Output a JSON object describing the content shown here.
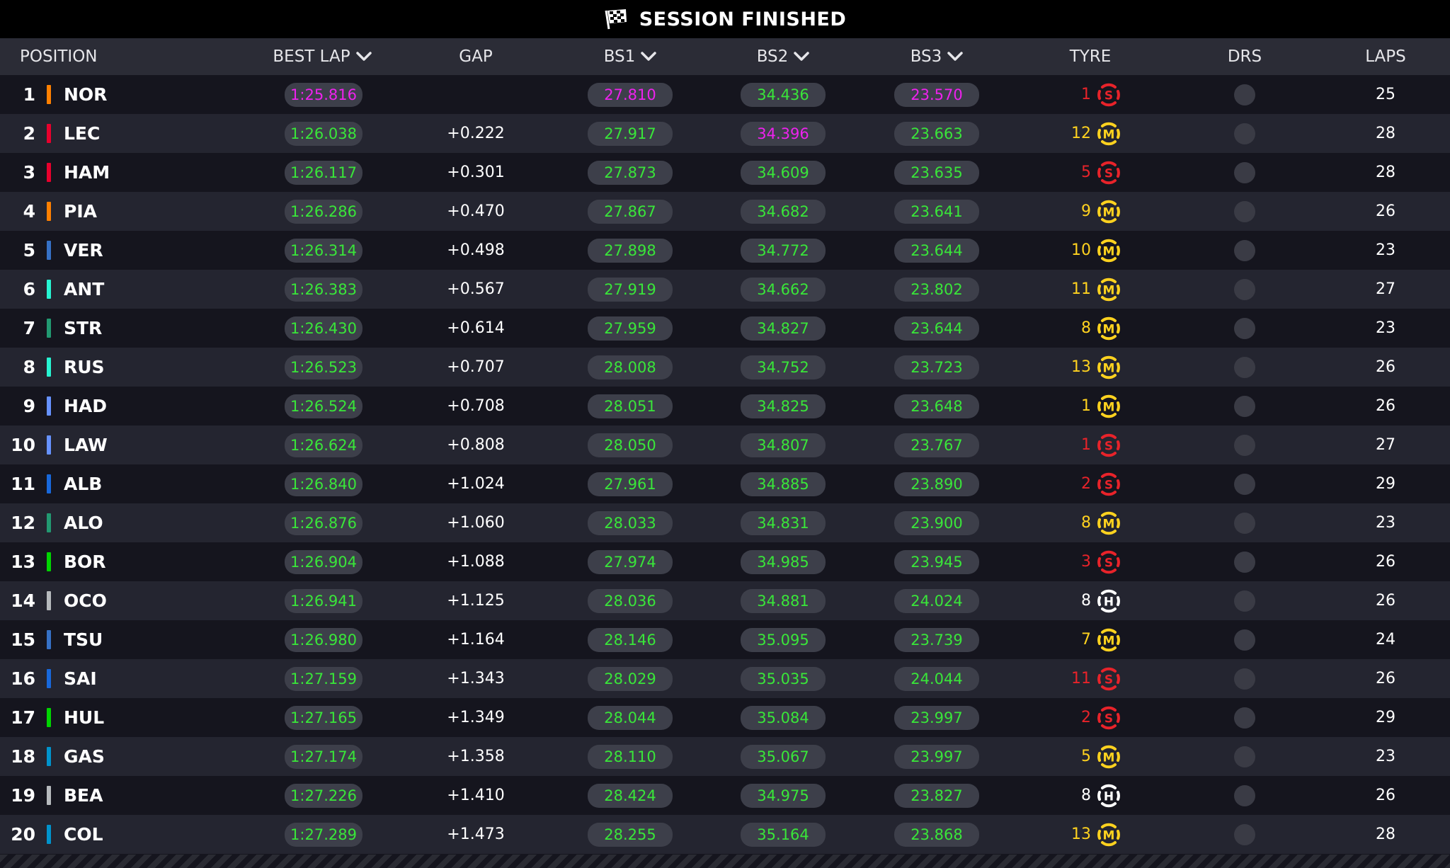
{
  "session_title": "SESSION FINISHED",
  "columns": {
    "position": "POSITION",
    "best_lap": "BEST LAP",
    "gap": "GAP",
    "bs1": "BS1",
    "bs2": "BS2",
    "bs3": "BS3",
    "tyre": "TYRE",
    "drs": "DRS",
    "laps": "LAPS"
  },
  "colors": {
    "personal_best": "#39e639",
    "overall_best": "#ee22ee",
    "soft": "#e8232a",
    "medium": "#ffd21f",
    "hard": "#ffffff"
  },
  "rows": [
    {
      "pos": "1",
      "driver": "NOR",
      "team_color": "#ff8000",
      "best_lap": "1:25.816",
      "best_lap_purple": true,
      "gap": "",
      "bs1": "27.810",
      "bs1_purple": true,
      "bs2": "34.436",
      "bs2_purple": false,
      "bs3": "23.570",
      "bs3_purple": true,
      "tyre_age": "1",
      "tyre": "S",
      "laps": "25"
    },
    {
      "pos": "2",
      "driver": "LEC",
      "team_color": "#e8002d",
      "best_lap": "1:26.038",
      "best_lap_purple": false,
      "gap": "+0.222",
      "bs1": "27.917",
      "bs1_purple": false,
      "bs2": "34.396",
      "bs2_purple": true,
      "bs3": "23.663",
      "bs3_purple": false,
      "tyre_age": "12",
      "tyre": "M",
      "laps": "28"
    },
    {
      "pos": "3",
      "driver": "HAM",
      "team_color": "#e8002d",
      "best_lap": "1:26.117",
      "best_lap_purple": false,
      "gap": "+0.301",
      "bs1": "27.873",
      "bs1_purple": false,
      "bs2": "34.609",
      "bs2_purple": false,
      "bs3": "23.635",
      "bs3_purple": false,
      "tyre_age": "5",
      "tyre": "S",
      "laps": "28"
    },
    {
      "pos": "4",
      "driver": "PIA",
      "team_color": "#ff8000",
      "best_lap": "1:26.286",
      "best_lap_purple": false,
      "gap": "+0.470",
      "bs1": "27.867",
      "bs1_purple": false,
      "bs2": "34.682",
      "bs2_purple": false,
      "bs3": "23.641",
      "bs3_purple": false,
      "tyre_age": "9",
      "tyre": "M",
      "laps": "26"
    },
    {
      "pos": "5",
      "driver": "VER",
      "team_color": "#3671c6",
      "best_lap": "1:26.314",
      "best_lap_purple": false,
      "gap": "+0.498",
      "bs1": "27.898",
      "bs1_purple": false,
      "bs2": "34.772",
      "bs2_purple": false,
      "bs3": "23.644",
      "bs3_purple": false,
      "tyre_age": "10",
      "tyre": "M",
      "laps": "23"
    },
    {
      "pos": "6",
      "driver": "ANT",
      "team_color": "#27f4d2",
      "best_lap": "1:26.383",
      "best_lap_purple": false,
      "gap": "+0.567",
      "bs1": "27.919",
      "bs1_purple": false,
      "bs2": "34.662",
      "bs2_purple": false,
      "bs3": "23.802",
      "bs3_purple": false,
      "tyre_age": "11",
      "tyre": "M",
      "laps": "27"
    },
    {
      "pos": "7",
      "driver": "STR",
      "team_color": "#229971",
      "best_lap": "1:26.430",
      "best_lap_purple": false,
      "gap": "+0.614",
      "bs1": "27.959",
      "bs1_purple": false,
      "bs2": "34.827",
      "bs2_purple": false,
      "bs3": "23.644",
      "bs3_purple": false,
      "tyre_age": "8",
      "tyre": "M",
      "laps": "23"
    },
    {
      "pos": "8",
      "driver": "RUS",
      "team_color": "#27f4d2",
      "best_lap": "1:26.523",
      "best_lap_purple": false,
      "gap": "+0.707",
      "bs1": "28.008",
      "bs1_purple": false,
      "bs2": "34.752",
      "bs2_purple": false,
      "bs3": "23.723",
      "bs3_purple": false,
      "tyre_age": "13",
      "tyre": "M",
      "laps": "26"
    },
    {
      "pos": "9",
      "driver": "HAD",
      "team_color": "#6692ff",
      "best_lap": "1:26.524",
      "best_lap_purple": false,
      "gap": "+0.708",
      "bs1": "28.051",
      "bs1_purple": false,
      "bs2": "34.825",
      "bs2_purple": false,
      "bs3": "23.648",
      "bs3_purple": false,
      "tyre_age": "1",
      "tyre": "M",
      "laps": "26"
    },
    {
      "pos": "10",
      "driver": "LAW",
      "team_color": "#6692ff",
      "best_lap": "1:26.624",
      "best_lap_purple": false,
      "gap": "+0.808",
      "bs1": "28.050",
      "bs1_purple": false,
      "bs2": "34.807",
      "bs2_purple": false,
      "bs3": "23.767",
      "bs3_purple": false,
      "tyre_age": "1",
      "tyre": "S",
      "laps": "27"
    },
    {
      "pos": "11",
      "driver": "ALB",
      "team_color": "#1868db",
      "best_lap": "1:26.840",
      "best_lap_purple": false,
      "gap": "+1.024",
      "bs1": "27.961",
      "bs1_purple": false,
      "bs2": "34.885",
      "bs2_purple": false,
      "bs3": "23.890",
      "bs3_purple": false,
      "tyre_age": "2",
      "tyre": "S",
      "laps": "29"
    },
    {
      "pos": "12",
      "driver": "ALO",
      "team_color": "#229971",
      "best_lap": "1:26.876",
      "best_lap_purple": false,
      "gap": "+1.060",
      "bs1": "28.033",
      "bs1_purple": false,
      "bs2": "34.831",
      "bs2_purple": false,
      "bs3": "23.900",
      "bs3_purple": false,
      "tyre_age": "8",
      "tyre": "M",
      "laps": "23"
    },
    {
      "pos": "13",
      "driver": "BOR",
      "team_color": "#00d400",
      "best_lap": "1:26.904",
      "best_lap_purple": false,
      "gap": "+1.088",
      "bs1": "27.974",
      "bs1_purple": false,
      "bs2": "34.985",
      "bs2_purple": false,
      "bs3": "23.945",
      "bs3_purple": false,
      "tyre_age": "3",
      "tyre": "S",
      "laps": "26"
    },
    {
      "pos": "14",
      "driver": "OCO",
      "team_color": "#b6babd",
      "best_lap": "1:26.941",
      "best_lap_purple": false,
      "gap": "+1.125",
      "bs1": "28.036",
      "bs1_purple": false,
      "bs2": "34.881",
      "bs2_purple": false,
      "bs3": "24.024",
      "bs3_purple": false,
      "tyre_age": "8",
      "tyre": "H",
      "laps": "26"
    },
    {
      "pos": "15",
      "driver": "TSU",
      "team_color": "#3671c6",
      "best_lap": "1:26.980",
      "best_lap_purple": false,
      "gap": "+1.164",
      "bs1": "28.146",
      "bs1_purple": false,
      "bs2": "35.095",
      "bs2_purple": false,
      "bs3": "23.739",
      "bs3_purple": false,
      "tyre_age": "7",
      "tyre": "M",
      "laps": "24"
    },
    {
      "pos": "16",
      "driver": "SAI",
      "team_color": "#1868db",
      "best_lap": "1:27.159",
      "best_lap_purple": false,
      "gap": "+1.343",
      "bs1": "28.029",
      "bs1_purple": false,
      "bs2": "35.035",
      "bs2_purple": false,
      "bs3": "24.044",
      "bs3_purple": false,
      "tyre_age": "11",
      "tyre": "S",
      "laps": "26"
    },
    {
      "pos": "17",
      "driver": "HUL",
      "team_color": "#00d400",
      "best_lap": "1:27.165",
      "best_lap_purple": false,
      "gap": "+1.349",
      "bs1": "28.044",
      "bs1_purple": false,
      "bs2": "35.084",
      "bs2_purple": false,
      "bs3": "23.997",
      "bs3_purple": false,
      "tyre_age": "2",
      "tyre": "S",
      "laps": "29"
    },
    {
      "pos": "18",
      "driver": "GAS",
      "team_color": "#0093cc",
      "best_lap": "1:27.174",
      "best_lap_purple": false,
      "gap": "+1.358",
      "bs1": "28.110",
      "bs1_purple": false,
      "bs2": "35.067",
      "bs2_purple": false,
      "bs3": "23.997",
      "bs3_purple": false,
      "tyre_age": "5",
      "tyre": "M",
      "laps": "23"
    },
    {
      "pos": "19",
      "driver": "BEA",
      "team_color": "#b6babd",
      "best_lap": "1:27.226",
      "best_lap_purple": false,
      "gap": "+1.410",
      "bs1": "28.424",
      "bs1_purple": false,
      "bs2": "34.975",
      "bs2_purple": false,
      "bs3": "23.827",
      "bs3_purple": false,
      "tyre_age": "8",
      "tyre": "H",
      "laps": "26"
    },
    {
      "pos": "20",
      "driver": "COL",
      "team_color": "#0093cc",
      "best_lap": "1:27.289",
      "best_lap_purple": false,
      "gap": "+1.473",
      "bs1": "28.255",
      "bs1_purple": false,
      "bs2": "35.164",
      "bs2_purple": false,
      "bs3": "23.868",
      "bs3_purple": false,
      "tyre_age": "13",
      "tyre": "M",
      "laps": "28"
    }
  ]
}
